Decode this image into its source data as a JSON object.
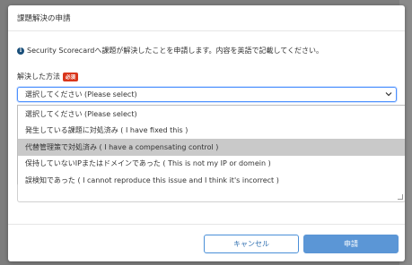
{
  "modal": {
    "title": "課題解決の申請",
    "info_text": "Security Scorecardへ課題が解決したことを申請します。内容を英語で記載してください。",
    "field_label": "解決した方法",
    "required_badge": "必須",
    "select": {
      "selected": "選択してください (Please select)"
    },
    "dropdown_options": [
      "選択してください (Please select)",
      "発生している課題に対処済み ( I have fixed this )",
      "代替管理策で対処済み ( I have a compensating control )",
      "保持していないIPまたはドメインであった ( This is not my IP or domein )",
      "誤検知であった ( I cannot reproduce this issue and I think it's incorrect )"
    ],
    "highlighted_option_index": 2,
    "buttons": {
      "cancel": "キャンセル",
      "submit": "申請"
    }
  },
  "colors": {
    "accent": "#4a8fd8",
    "submit_bg": "#5b96d6",
    "required_badge": "#d9361c",
    "highlight": "#c9c9c9"
  },
  "icons": {
    "info": "info-icon",
    "chevron": "chevron-down-icon"
  }
}
